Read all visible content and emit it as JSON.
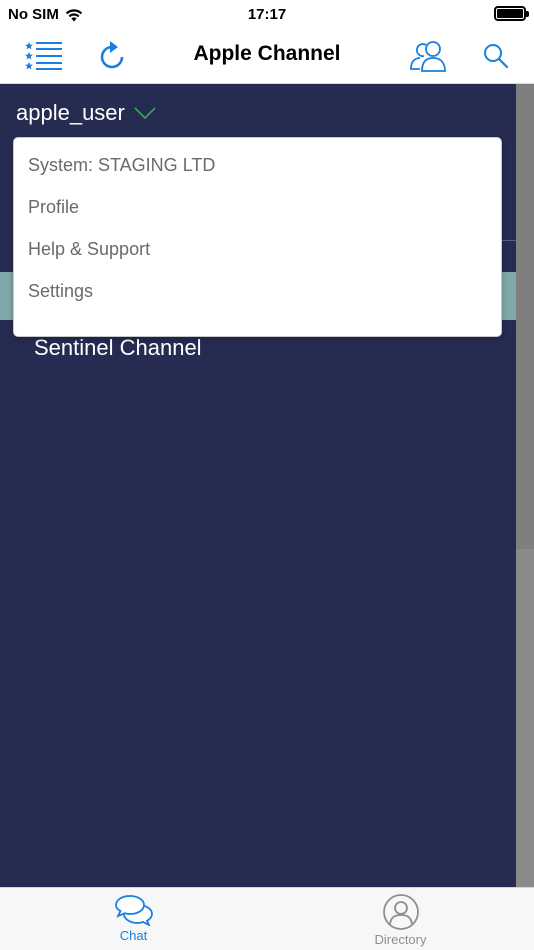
{
  "status_bar": {
    "carrier": "No SIM",
    "time": "17:17"
  },
  "nav": {
    "title": "Apple Channel",
    "left_icons": [
      "menu-list-icon",
      "refresh-icon"
    ],
    "right_icons": [
      "users-icon",
      "search-icon"
    ]
  },
  "drawer": {
    "account_name": "apple_user",
    "channels": [
      "Sentinel Channel"
    ]
  },
  "dropdown": {
    "items": [
      "System: STAGING LTD",
      "Profile",
      "Help & Support",
      "Settings"
    ]
  },
  "tabs": [
    {
      "label": "Chat",
      "icon": "chat-bubbles-icon",
      "active": true
    },
    {
      "label": "Directory",
      "icon": "person-circle-icon",
      "active": false
    }
  ],
  "colors": {
    "accent": "#1a7fe0",
    "drawer_bg": "#262b52",
    "chevron": "#2fa84f",
    "teal_row": "#7fa9a9",
    "inactive_tab": "#8e8e8e"
  }
}
